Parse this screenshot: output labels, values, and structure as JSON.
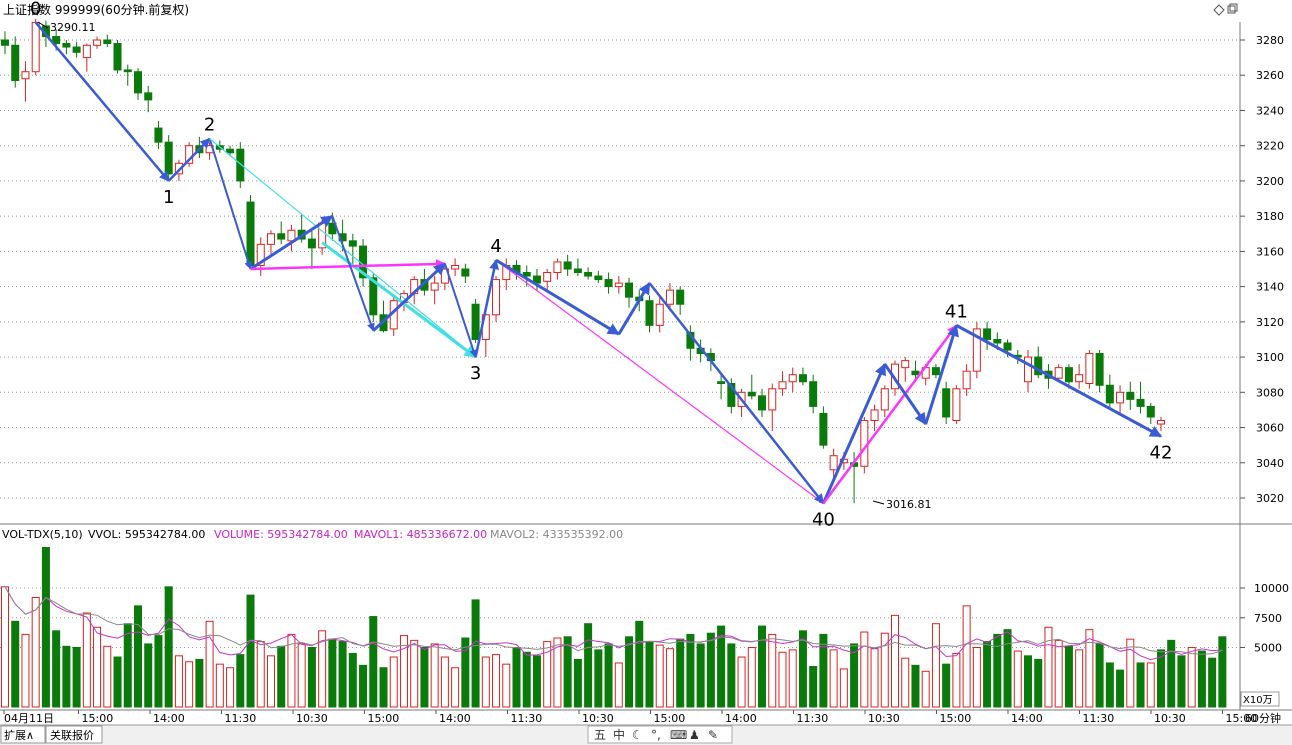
{
  "header": {
    "title": "上证指数 999999(60分钟.前复权)",
    "icon_names": [
      "diamond-icon",
      "restore-window-icon"
    ]
  },
  "chart_data": {
    "type": "candlestick",
    "price_axis": {
      "ticks": [
        3020,
        3040,
        3060,
        3080,
        3100,
        3120,
        3140,
        3160,
        3180,
        3200,
        3220,
        3240,
        3260,
        3280
      ]
    },
    "max_label": "3290.11",
    "min_label": "3016.81",
    "candles": [
      [
        3280,
        3285,
        3272,
        3277
      ],
      [
        3277,
        3282,
        3253,
        3257
      ],
      [
        3258,
        3268,
        3245,
        3262
      ],
      [
        3262,
        3292,
        3260,
        3290
      ],
      [
        3288,
        3291,
        3276,
        3282
      ],
      [
        3282,
        3286,
        3274,
        3278
      ],
      [
        3278,
        3280,
        3272,
        3276
      ],
      [
        3276,
        3279,
        3270,
        3273
      ],
      [
        3270,
        3278,
        3262,
        3277
      ],
      [
        3277,
        3282,
        3275,
        3280
      ],
      [
        3280,
        3283,
        3276,
        3278
      ],
      [
        3278,
        3280,
        3261,
        3263
      ],
      [
        3263,
        3266,
        3254,
        3262
      ],
      [
        3262,
        3264,
        3246,
        3250
      ],
      [
        3250,
        3254,
        3239,
        3246
      ],
      [
        3230,
        3234,
        3218,
        3222
      ],
      [
        3222,
        3226,
        3200,
        3204
      ],
      [
        3204,
        3212,
        3200,
        3210
      ],
      [
        3210,
        3222,
        3208,
        3220
      ],
      [
        3220,
        3225,
        3213,
        3216
      ],
      [
        3216,
        3222,
        3212,
        3220
      ],
      [
        3220,
        3223,
        3216,
        3218
      ],
      [
        3218,
        3220,
        3214,
        3216
      ],
      [
        3218,
        3222,
        3196,
        3200
      ],
      [
        3188,
        3192,
        3150,
        3152
      ],
      [
        3152,
        3168,
        3146,
        3164
      ],
      [
        3164,
        3172,
        3158,
        3170
      ],
      [
        3170,
        3177,
        3164,
        3167
      ],
      [
        3166,
        3175,
        3160,
        3172
      ],
      [
        3172,
        3181,
        3165,
        3167
      ],
      [
        3167,
        3172,
        3150,
        3162
      ],
      [
        3162,
        3178,
        3158,
        3176
      ],
      [
        3176,
        3182,
        3166,
        3170
      ],
      [
        3170,
        3178,
        3160,
        3166
      ],
      [
        3166,
        3170,
        3152,
        3163
      ],
      [
        3163,
        3167,
        3140,
        3145
      ],
      [
        3145,
        3148,
        3120,
        3124
      ],
      [
        3124,
        3132,
        3114,
        3115
      ],
      [
        3116,
        3134,
        3112,
        3132
      ],
      [
        3131,
        3138,
        3126,
        3136
      ],
      [
        3136,
        3146,
        3130,
        3144
      ],
      [
        3144,
        3150,
        3135,
        3138
      ],
      [
        3138,
        3146,
        3130,
        3142
      ],
      [
        3142,
        3152,
        3138,
        3150
      ],
      [
        3150,
        3156,
        3146,
        3152
      ],
      [
        3150,
        3153,
        3142,
        3146
      ],
      [
        3130,
        3133,
        3108,
        3110
      ],
      [
        3110,
        3125,
        3100,
        3124
      ],
      [
        3124,
        3146,
        3120,
        3144
      ],
      [
        3144,
        3156,
        3138,
        3152
      ],
      [
        3152,
        3155,
        3144,
        3148
      ],
      [
        3148,
        3152,
        3140,
        3146
      ],
      [
        3146,
        3150,
        3138,
        3142
      ],
      [
        3143,
        3150,
        3138,
        3148
      ],
      [
        3148,
        3156,
        3144,
        3154
      ],
      [
        3154,
        3158,
        3146,
        3150
      ],
      [
        3150,
        3156,
        3146,
        3148
      ],
      [
        3148,
        3151,
        3144,
        3146
      ],
      [
        3146,
        3149,
        3142,
        3144
      ],
      [
        3144,
        3148,
        3136,
        3140
      ],
      [
        3140,
        3146,
        3136,
        3142
      ],
      [
        3142,
        3145,
        3128,
        3134
      ],
      [
        3134,
        3138,
        3126,
        3132
      ],
      [
        3132,
        3135,
        3114,
        3118
      ],
      [
        3118,
        3134,
        3114,
        3130
      ],
      [
        3130,
        3142,
        3126,
        3138
      ],
      [
        3138,
        3140,
        3124,
        3130
      ],
      [
        3114,
        3118,
        3098,
        3105
      ],
      [
        3105,
        3110,
        3097,
        3102
      ],
      [
        3102,
        3105,
        3092,
        3098
      ],
      [
        3086,
        3090,
        3076,
        3085
      ],
      [
        3085,
        3088,
        3068,
        3072
      ],
      [
        3072,
        3082,
        3066,
        3080
      ],
      [
        3080,
        3090,
        3076,
        3078
      ],
      [
        3078,
        3082,
        3066,
        3070
      ],
      [
        3070,
        3085,
        3058,
        3082
      ],
      [
        3082,
        3092,
        3078,
        3086
      ],
      [
        3086,
        3094,
        3080,
        3090
      ],
      [
        3090,
        3094,
        3084,
        3086
      ],
      [
        3086,
        3090,
        3068,
        3072
      ],
      [
        3068,
        3072,
        3048,
        3050
      ],
      [
        3036,
        3048,
        3030,
        3044
      ],
      [
        3040,
        3046,
        3036,
        3042
      ],
      [
        3040,
        3046,
        3017,
        3038
      ],
      [
        3038,
        3066,
        3034,
        3064
      ],
      [
        3064,
        3073,
        3058,
        3070
      ],
      [
        3070,
        3084,
        3066,
        3082
      ],
      [
        3082,
        3098,
        3078,
        3096
      ],
      [
        3094,
        3100,
        3086,
        3098
      ],
      [
        3092,
        3098,
        3086,
        3090
      ],
      [
        3088,
        3096,
        3084,
        3094
      ],
      [
        3094,
        3096,
        3088,
        3090
      ],
      [
        3082,
        3086,
        3062,
        3066
      ],
      [
        3064,
        3084,
        3062,
        3082
      ],
      [
        3082,
        3096,
        3078,
        3092
      ],
      [
        3092,
        3120,
        3088,
        3116
      ],
      [
        3116,
        3120,
        3104,
        3110
      ],
      [
        3110,
        3114,
        3104,
        3108
      ],
      [
        3108,
        3110,
        3100,
        3104
      ],
      [
        3101,
        3104,
        3096,
        3100
      ],
      [
        3086,
        3104,
        3080,
        3100
      ],
      [
        3100,
        3106,
        3088,
        3090
      ],
      [
        3092,
        3096,
        3082,
        3088
      ],
      [
        3088,
        3096,
        3086,
        3094
      ],
      [
        3094,
        3096,
        3082,
        3086
      ],
      [
        3086,
        3096,
        3082,
        3090
      ],
      [
        3085,
        3104,
        3082,
        3102
      ],
      [
        3102,
        3104,
        3080,
        3084
      ],
      [
        3084,
        3090,
        3070,
        3074
      ],
      [
        3074,
        3084,
        3068,
        3080
      ],
      [
        3080,
        3086,
        3070,
        3076
      ],
      [
        3076,
        3086,
        3068,
        3072
      ],
      [
        3072,
        3074,
        3062,
        3066
      ],
      [
        3062,
        3066,
        3058,
        3064
      ]
    ],
    "wave_labels": [
      {
        "label": "0",
        "i": 3,
        "price": 3290,
        "pos": "above"
      },
      {
        "label": "1",
        "i": 16,
        "price": 3200,
        "pos": "below"
      },
      {
        "label": "2",
        "i": 20,
        "price": 3224,
        "pos": "above"
      },
      {
        "label": "3",
        "i": 46,
        "price": 3100,
        "pos": "below"
      },
      {
        "label": "4",
        "i": 48,
        "price": 3155,
        "pos": "above"
      },
      {
        "label": "40",
        "i": 80,
        "price": 3017,
        "pos": "below"
      },
      {
        "label": "41",
        "i": 93,
        "price": 3118,
        "pos": "above"
      },
      {
        "label": "42",
        "i": 113,
        "price": 3055,
        "pos": "below"
      }
    ],
    "wave_lines": [
      {
        "from": [
          3,
          3290
        ],
        "to": [
          16,
          3200
        ],
        "color": "#3a5bd6",
        "width": 2.5,
        "arrow": true
      },
      {
        "from": [
          16,
          3200
        ],
        "to": [
          20,
          3224
        ],
        "color": "#3a5bd6",
        "width": 2.5,
        "arrow": true
      },
      {
        "from": [
          20,
          3224
        ],
        "to": [
          24,
          3150
        ],
        "color": "#3a5bd6",
        "width": 2,
        "arrow": true
      },
      {
        "from": [
          20,
          3224
        ],
        "to": [
          46,
          3100
        ],
        "color": "#40e0e0",
        "width": 1.2,
        "arrow": false
      },
      {
        "from": [
          31,
          3165
        ],
        "to": [
          46,
          3100
        ],
        "color": "#40e0e0",
        "width": 3,
        "arrow": true
      },
      {
        "from": [
          24,
          3150
        ],
        "to": [
          32,
          3180
        ],
        "color": "#3a5bd6",
        "width": 3,
        "arrow": true
      },
      {
        "from": [
          24,
          3150
        ],
        "to": [
          43,
          3153
        ],
        "color": "#ff33ff",
        "width": 2.5,
        "arrow": true
      },
      {
        "from": [
          32,
          3180
        ],
        "to": [
          36,
          3115
        ],
        "color": "#3a5bd6",
        "width": 2,
        "arrow": true
      },
      {
        "from": [
          36,
          3115
        ],
        "to": [
          43,
          3153
        ],
        "color": "#3a5bd6",
        "width": 3,
        "arrow": true
      },
      {
        "from": [
          43,
          3153
        ],
        "to": [
          46,
          3100
        ],
        "color": "#3a5bd6",
        "width": 2,
        "arrow": true
      },
      {
        "from": [
          46,
          3100
        ],
        "to": [
          48,
          3155
        ],
        "color": "#3a5bd6",
        "width": 2.5,
        "arrow": true
      },
      {
        "from": [
          48,
          3155
        ],
        "to": [
          80,
          3017
        ],
        "color": "#ff33ff",
        "width": 1.2,
        "arrow": true
      },
      {
        "from": [
          48,
          3155
        ],
        "to": [
          60,
          3113
        ],
        "color": "#3a5bd6",
        "width": 3,
        "arrow": true
      },
      {
        "from": [
          60,
          3113
        ],
        "to": [
          63,
          3142
        ],
        "color": "#3a5bd6",
        "width": 3,
        "arrow": true
      },
      {
        "from": [
          63,
          3142
        ],
        "to": [
          80,
          3017
        ],
        "color": "#3a5bd6",
        "width": 2.5,
        "arrow": true
      },
      {
        "from": [
          80,
          3017
        ],
        "to": [
          86,
          3096
        ],
        "color": "#3a5bd6",
        "width": 3,
        "arrow": true
      },
      {
        "from": [
          80,
          3017
        ],
        "to": [
          93,
          3118
        ],
        "color": "#ff33ff",
        "width": 2.5,
        "arrow": true
      },
      {
        "from": [
          86,
          3096
        ],
        "to": [
          90,
          3062
        ],
        "color": "#3a5bd6",
        "width": 3,
        "arrow": true
      },
      {
        "from": [
          90,
          3062
        ],
        "to": [
          93,
          3118
        ],
        "color": "#3a5bd6",
        "width": 3,
        "arrow": true
      },
      {
        "from": [
          93,
          3118
        ],
        "to": [
          113,
          3055
        ],
        "color": "#3a5bd6",
        "width": 3,
        "arrow": true
      }
    ],
    "volume": {
      "header": {
        "name": "VOL-TDX(5,10)",
        "vvol": "VVOL: 595342784.00",
        "volume": "VOLUME: 595342784.00",
        "mavol1": "MAVOL1: 485336672.00",
        "mavol2": "MAVOL2: 433535392.00"
      },
      "ticks": [
        5000,
        7500,
        10000
      ],
      "unit_label": "X10万",
      "values": [
        10100,
        7200,
        6100,
        9200,
        13400,
        6400,
        5100,
        5000,
        7900,
        6700,
        5100,
        4200,
        7000,
        8500,
        5300,
        6000,
        10100,
        4300,
        3800,
        4000,
        7200,
        3600,
        3300,
        4400,
        9400,
        5500,
        4300,
        5100,
        6100,
        5300,
        5000,
        6400,
        5700,
        5500,
        4500,
        3500,
        7600,
        3300,
        4200,
        6000,
        5600,
        5000,
        5300,
        4200,
        3300,
        5800,
        9000,
        4200,
        4400,
        3600,
        5000,
        4600,
        4300,
        5500,
        5800,
        5900,
        4000,
        7000,
        4800,
        5300,
        3700,
        5900,
        7200,
        5500,
        5200,
        4900,
        5700,
        6100,
        5300,
        6200,
        6800,
        5300,
        4200,
        5000,
        6800,
        6100,
        4600,
        4800,
        6400,
        3400,
        6100,
        4800,
        3200,
        5300,
        6300,
        4900,
        6200,
        7700,
        4100,
        3500,
        3000,
        7000,
        3600,
        4500,
        8500,
        5000,
        5500,
        6100,
        6500,
        4700,
        4300,
        4000,
        6700,
        5600,
        5100,
        4800,
        6500,
        5300,
        3700,
        3100,
        5700,
        3700,
        3700,
        4800,
        5600,
        4300,
        5000,
        4700,
        4100,
        5900
      ],
      "up_flags": [
        1,
        0,
        1,
        1,
        0,
        0,
        0,
        0,
        1,
        1,
        1,
        0,
        0,
        0,
        0,
        0,
        0,
        1,
        1,
        0,
        1,
        1,
        1,
        0,
        0,
        1,
        1,
        0,
        1,
        1,
        0,
        1,
        0,
        0,
        0,
        0,
        0,
        0,
        1,
        1,
        1,
        0,
        1,
        1,
        1,
        0,
        0,
        1,
        1,
        1,
        0,
        0,
        0,
        1,
        1,
        0,
        0,
        0,
        0,
        0,
        1,
        0,
        0,
        0,
        1,
        1,
        0,
        0,
        0,
        0,
        0,
        0,
        1,
        1,
        0,
        1,
        1,
        1,
        0,
        0,
        0,
        1,
        1,
        0,
        1,
        1,
        1,
        1,
        1,
        0,
        1,
        1,
        0,
        1,
        1,
        1,
        0,
        0,
        0,
        1,
        0,
        0,
        1,
        1,
        0,
        1,
        1,
        0,
        0,
        0,
        1,
        0,
        1,
        0,
        0,
        0,
        1,
        0
      ]
    },
    "time_labels": [
      "04月11日",
      "15:00",
      "14:00",
      "11:30",
      "10:30",
      "15:00",
      "14:00",
      "11:30",
      "10:30",
      "15:00",
      "14:00",
      "11:30",
      "10:30",
      "15:00",
      "14:00",
      "11:30",
      "10:30",
      "15:00"
    ],
    "period_label": "60分钟"
  },
  "bottom_bar": {
    "tabs": [
      "扩展∧",
      "关联报价"
    ],
    "toolbar_icons": [
      {
        "name": "five-icon",
        "glyph": "五"
      },
      {
        "name": "chinese-input-icon",
        "glyph": "中"
      },
      {
        "name": "moon-icon",
        "glyph": "☾"
      },
      {
        "name": "punctuation-icon",
        "glyph": "°,"
      },
      {
        "name": "keyboard-icon",
        "glyph": "⌨"
      },
      {
        "name": "user-icon",
        "glyph": "♟"
      },
      {
        "name": "wrench-icon",
        "glyph": "✎"
      }
    ]
  },
  "colors": {
    "up": "#dd2222",
    "down": "#0a7a0a",
    "mavol1": "#cc33cc",
    "mavol2": "#888888",
    "grid": "#9a9a9a"
  }
}
